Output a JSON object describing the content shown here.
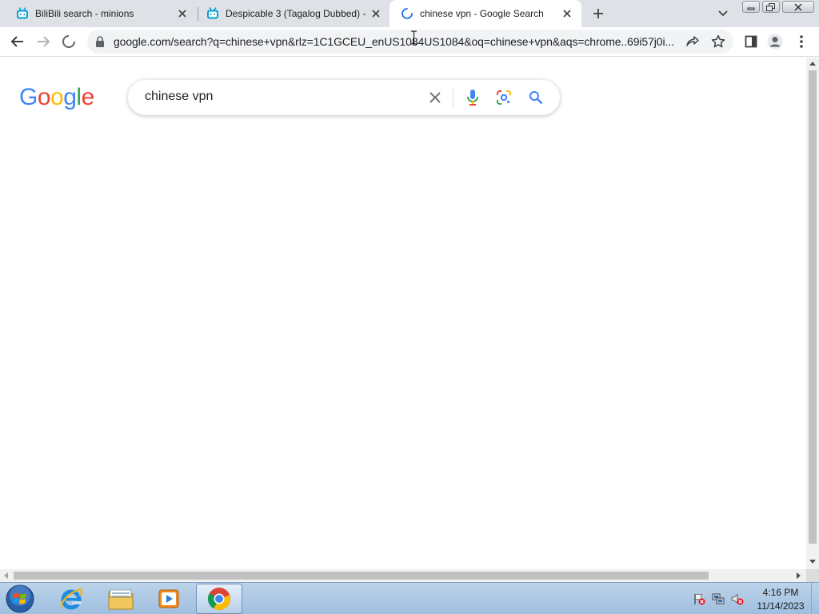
{
  "browser": {
    "tabs": [
      {
        "title": "BiliBili search - minions",
        "favicon": "bilibili-icon",
        "active": false
      },
      {
        "title": "Despicable 3 (Tagalog Dubbed) -",
        "favicon": "bilibili-icon",
        "active": false
      },
      {
        "title": "chinese vpn - Google Search",
        "favicon": "loading-spinner-icon",
        "active": true
      }
    ],
    "url": "google.com/search?q=chinese+vpn&rlz=1C1GCEU_enUS1084US1084&oq=chinese+vpn&aqs=chrome..69i57j0i...",
    "loading": true
  },
  "page": {
    "logo_text": "Google",
    "logo_colors": [
      "#4285F4",
      "#EA4335",
      "#FBBC05",
      "#4285F4",
      "#34A853",
      "#EA4335"
    ],
    "search": {
      "query": "chinese vpn"
    }
  },
  "taskbar": {
    "apps": [
      "internet-explorer-icon",
      "windows-explorer-icon",
      "media-player-icon",
      "chrome-icon"
    ],
    "active_app": "chrome-icon",
    "clock": {
      "time": "4:16 PM",
      "date": "11/14/2023"
    }
  },
  "colors": {
    "tab_strip": "#dee1e6",
    "accent_blue": "#4285F4",
    "taskbar": "#a9c5e2"
  }
}
